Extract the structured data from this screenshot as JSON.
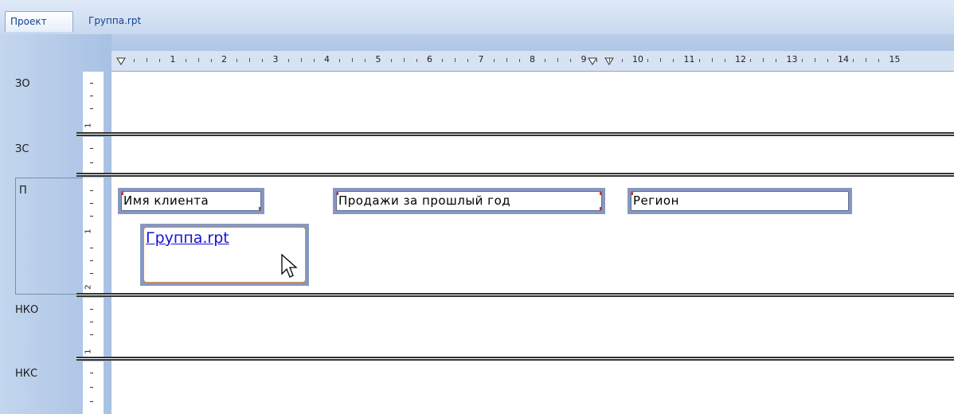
{
  "tabs": [
    {
      "label": "Проект"
    },
    {
      "label": "Группа.rpt"
    }
  ],
  "ruler": {
    "numbers": [
      "1",
      "2",
      "3",
      "4",
      "5",
      "6",
      "7",
      "8",
      "9",
      "10",
      "11",
      "12",
      "13",
      "14",
      "15"
    ]
  },
  "sections": [
    {
      "label": "ЗО",
      "vnum": "1"
    },
    {
      "label": "ЗС"
    },
    {
      "label": "П",
      "vnum1": "1",
      "vnum2": "2"
    },
    {
      "label": "НКО",
      "vnum": "1"
    },
    {
      "label": "НКС"
    }
  ],
  "fields": {
    "client_name": "Имя клиента",
    "last_year_sales": "Продажи за прошлый год",
    "region": "Регион",
    "subreport": "Группа.rpt"
  },
  "colors": {
    "tab_text": "#15428b",
    "link": "#1313d6",
    "selection_border": "#e08a3c",
    "field_frame": "#8797bf"
  }
}
